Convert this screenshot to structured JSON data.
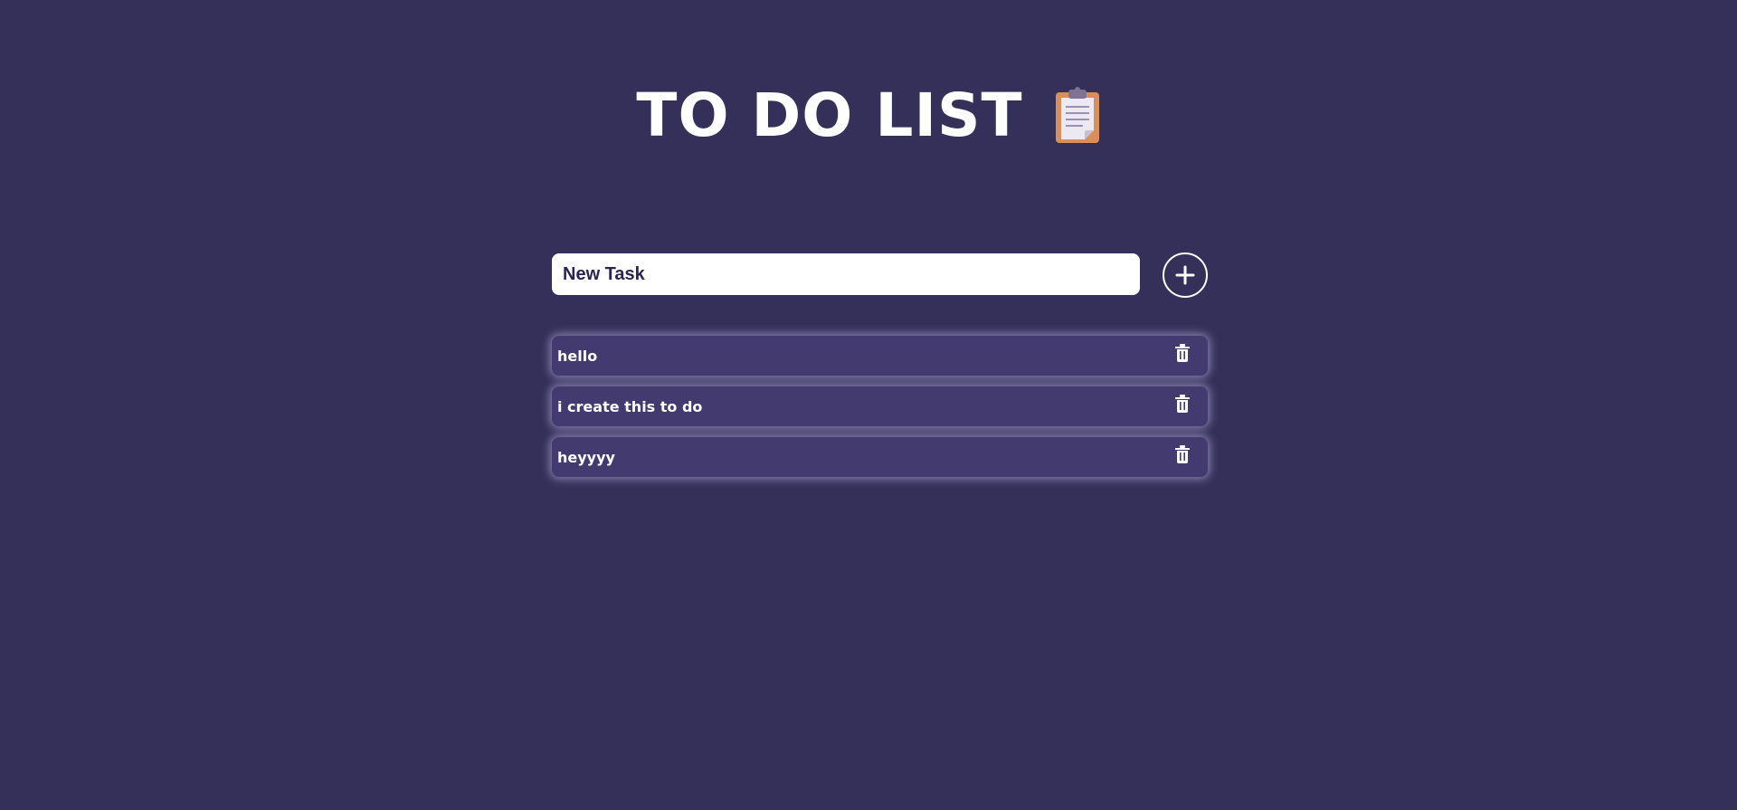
{
  "header": {
    "title": "TO DO LIST",
    "icon": "clipboard-icon"
  },
  "input": {
    "placeholder": "New Task",
    "value": ""
  },
  "add_button": {
    "icon": "plus-icon"
  },
  "tasks": [
    {
      "text": "hello",
      "icon": "trash-icon"
    },
    {
      "text": "i create this to do",
      "icon": "trash-icon"
    },
    {
      "text": "heyyyy",
      "icon": "trash-icon"
    }
  ],
  "colors": {
    "background": "#35305a",
    "task_background": "#433a70",
    "text": "#ffffff",
    "input_text": "#2c2350"
  }
}
